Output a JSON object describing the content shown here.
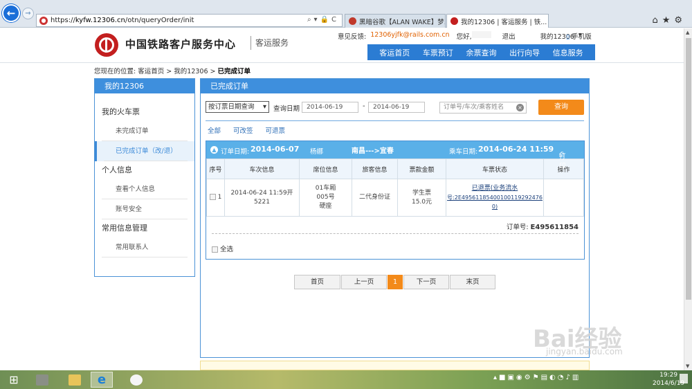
{
  "browser": {
    "url_prefix": "https://",
    "url_host": "kyfw.12306.cn",
    "url_path": "/otn/queryOrder/init",
    "tab1": "黑暗谷歌【ALAN WAKE】梦...",
    "tab2": "我的12306 | 客运服务 | 铁...",
    "tab_close": "×"
  },
  "header": {
    "site_name": "中国铁路客户服务中心",
    "site_sub": "客运服务",
    "feedback_label": "意见反馈:",
    "feedback_email": "12306yjfk@rails.com.cn",
    "greeting": "您好,",
    "logout": "退出",
    "my12306": "我的12306",
    "mobile": "手机版",
    "nav": [
      "客运首页",
      "车票预订",
      "余票查询",
      "出行向导",
      "信息服务"
    ]
  },
  "breadcrumb": {
    "prefix": "您现在的位置:",
    "home": "客运首页",
    "sep": ">",
    "my": "我的12306",
    "current": "已完成订单"
  },
  "sidebar": {
    "title": "我的12306",
    "sections": [
      {
        "label": "我的火车票",
        "items": [
          "未完成订单",
          "已完成订单（改/退）"
        ]
      },
      {
        "label": "个人信息",
        "items": [
          "查看个人信息",
          "账号安全"
        ]
      },
      {
        "label": "常用信息管理",
        "items": [
          "常用联系人"
        ]
      }
    ]
  },
  "panel": {
    "title": "已完成订单",
    "filter_type": "按订票日期查询",
    "date_label": "查询日期",
    "date_from": "2014-06-19",
    "date_dash": "-",
    "date_to": "2014-06-19",
    "search_placeholder": "订单号/车次/乘客姓名",
    "query_button": "查询",
    "tabs": [
      "全部",
      "可改签",
      "可退票"
    ]
  },
  "order": {
    "order_date_label": "订单日期:",
    "order_date": "2014-06-07",
    "passenger": "杨娜",
    "route": "南昌--->宜春",
    "ride_date_label": "乘车日期:",
    "ride_date": "2014-06-24 11:59",
    "print": "打印",
    "columns": [
      "序号",
      "车次信息",
      "席位信息",
      "旅客信息",
      "票款金额",
      "车票状态",
      "操作"
    ],
    "row": {
      "index": "1",
      "train_time": "2014-06-24 11:59开",
      "train_no": "5221",
      "car": "01车厢",
      "seat": "005号",
      "seat_type": "硬座",
      "id_type": "二代身份证",
      "ticket_type": "学生票",
      "price": "15.0元",
      "status_line1": "已退票(业务流水",
      "status_line2": "号:2E49561185400100119292476​0)"
    },
    "order_no_label": "订单号:",
    "order_no": "E495611854",
    "select_all": "全选"
  },
  "pager": [
    "首页",
    "上一页",
    "1",
    "下一页",
    "末页"
  ],
  "yellow_text": "",
  "watermark": {
    "main": "Bai经验",
    "sub": "jingyan.baidu.com"
  },
  "taskbar": {
    "time": "19:29",
    "date": "2014/6/19"
  },
  "colors": {
    "brand_blue": "#3e8fdd",
    "accent_orange": "#f38a1a",
    "logo_red": "#c31f1f"
  }
}
